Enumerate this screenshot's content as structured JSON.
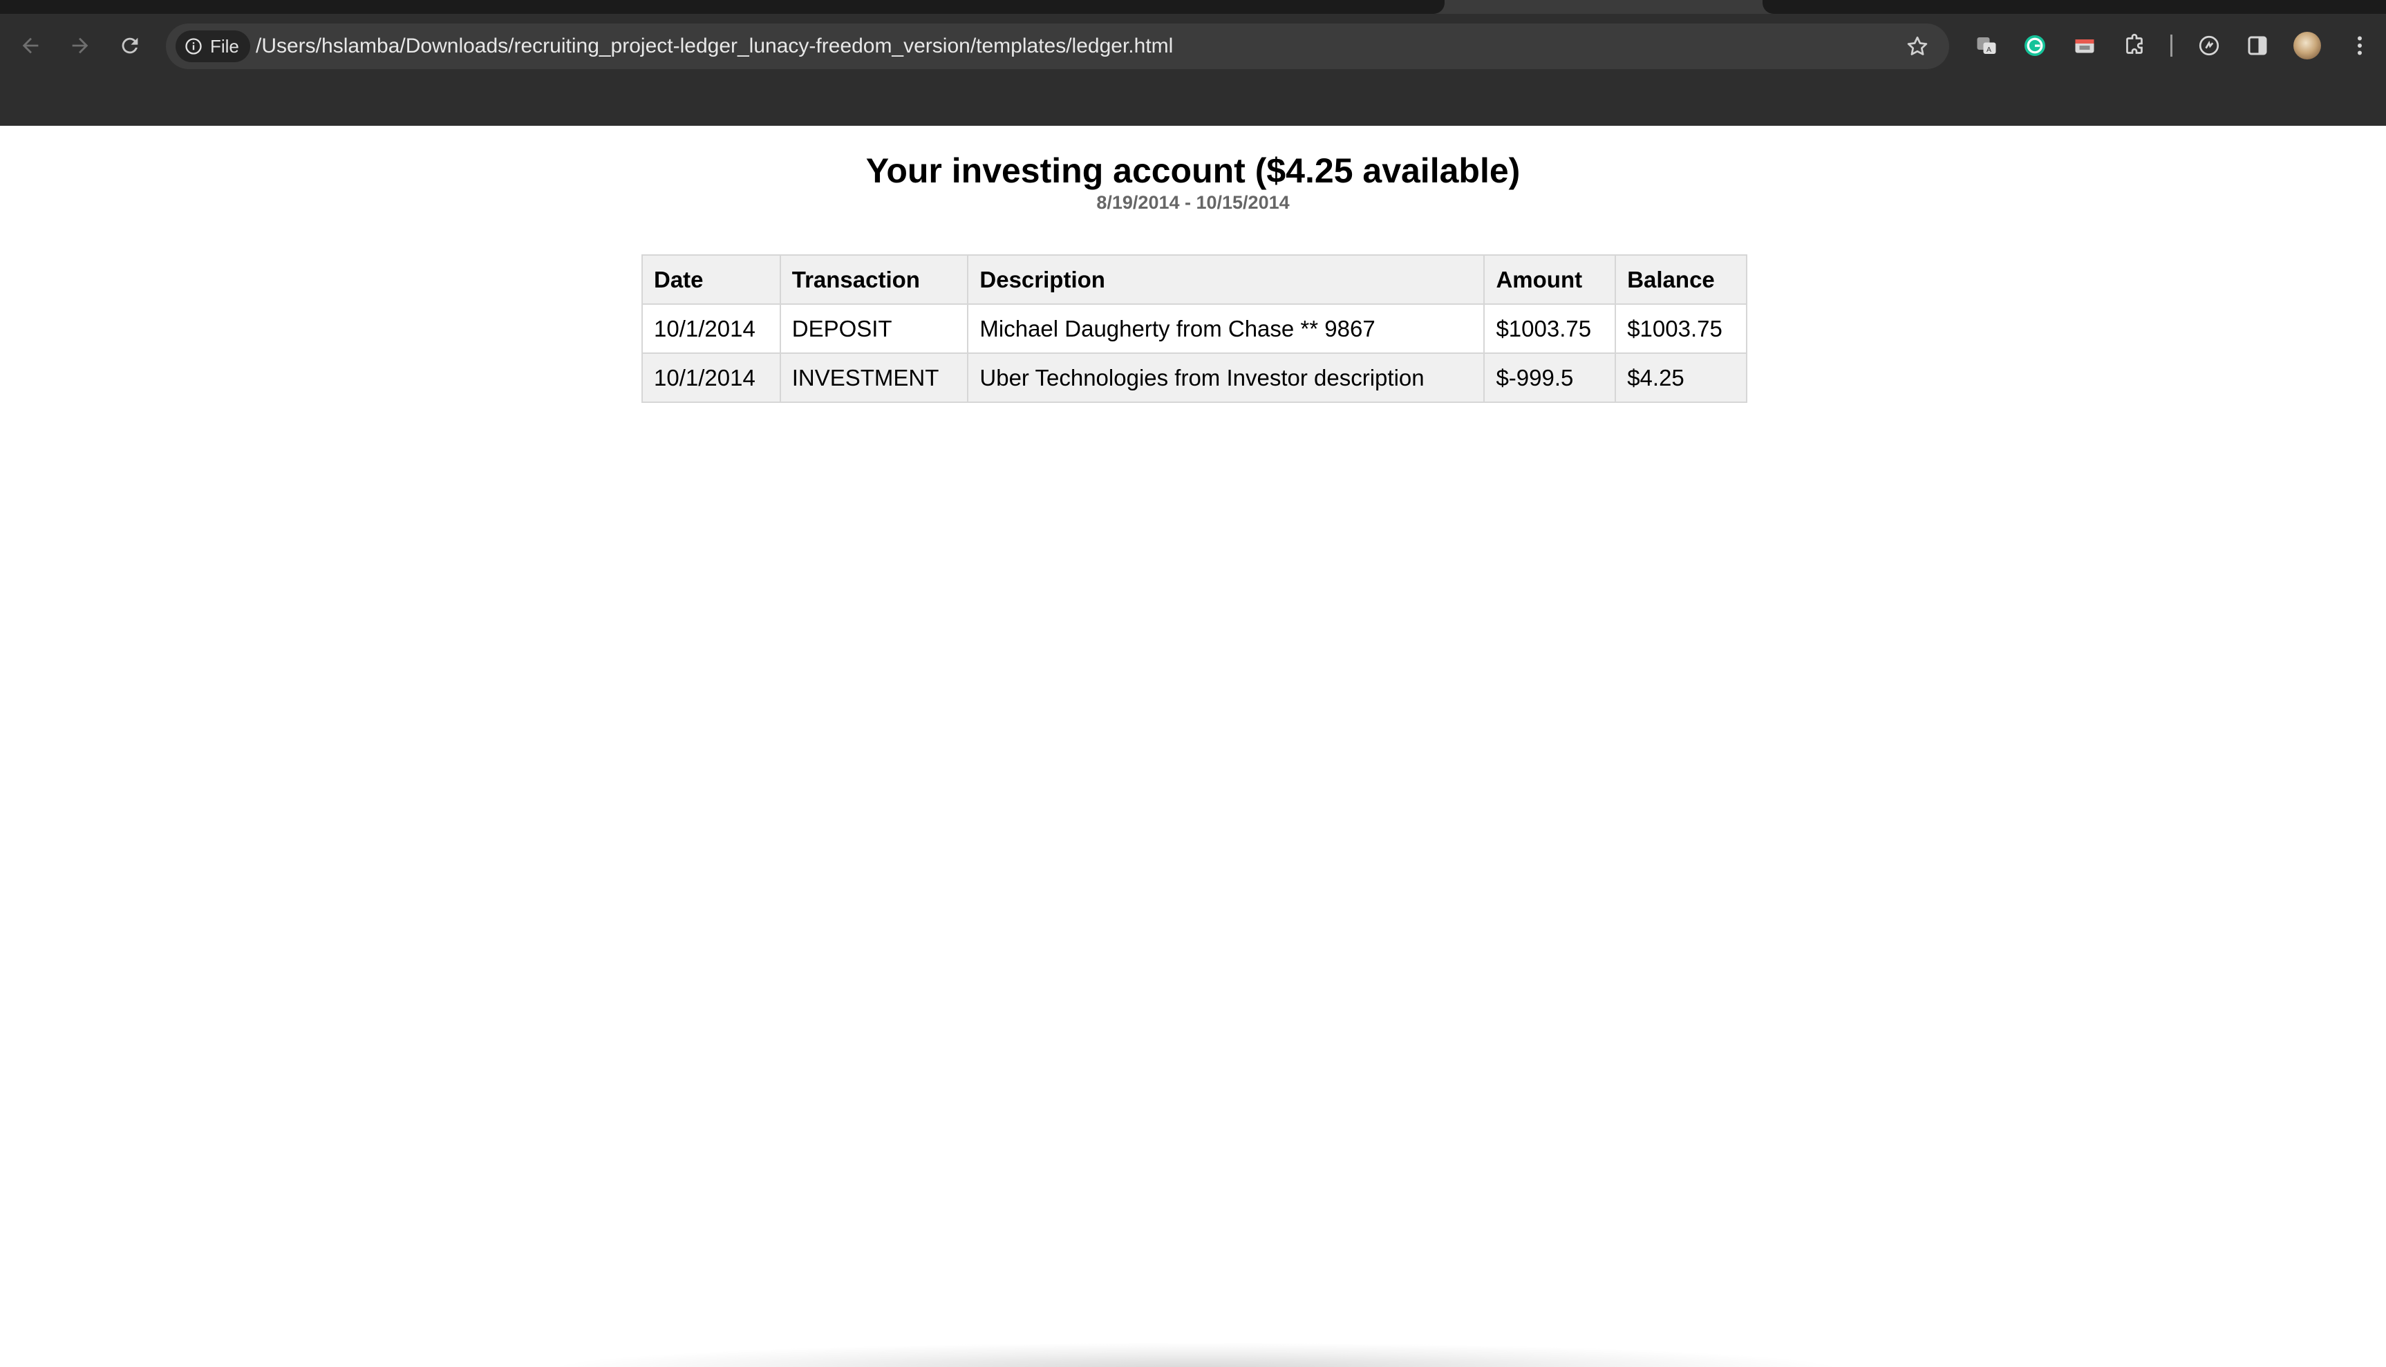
{
  "browser": {
    "url_scheme_label": "File",
    "url": "/Users/hslamba/Downloads/recruiting_project-ledger_lunacy-freedom_version/templates/ledger.html",
    "icons": [
      "back-arrow-icon",
      "forward-arrow-icon",
      "reload-icon",
      "info-icon",
      "star-icon",
      "extension-icons",
      "puzzle-icon",
      "sync-icon",
      "side-panel-icon",
      "avatar",
      "kebab-menu-icon"
    ]
  },
  "page": {
    "title": "Your investing account ($4.25 available)",
    "date_range": "8/19/2014 - 10/15/2014"
  },
  "ledger": {
    "headers": {
      "date": "Date",
      "transaction": "Transaction",
      "description": "Description",
      "amount": "Amount",
      "balance": "Balance"
    },
    "rows": [
      {
        "date": "10/1/2014",
        "transaction": "DEPOSIT",
        "description": "Michael Daugherty from Chase ** 9867",
        "amount": "$1003.75",
        "balance": "$1003.75"
      },
      {
        "date": "10/1/2014",
        "transaction": "INVESTMENT",
        "description": "Uber Technologies from Investor description",
        "amount": "$-999.5",
        "balance": "$4.25"
      }
    ]
  }
}
